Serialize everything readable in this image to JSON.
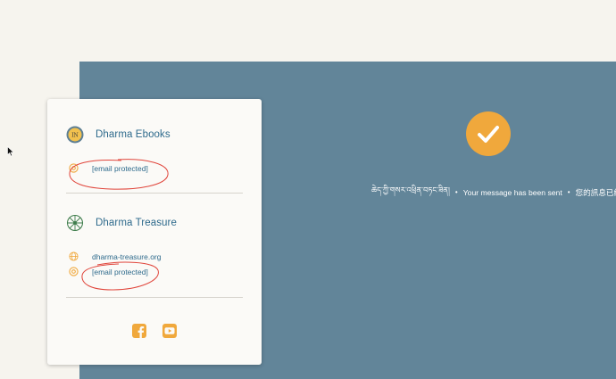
{
  "card": {
    "org1": {
      "name": "Dharma Ebooks",
      "logo_icon": "dharma-ebooks-logo",
      "email": "[email protected]"
    },
    "org2": {
      "name": "Dharma Treasure",
      "logo_icon": "dharma-wheel-logo",
      "website": "dharma-treasure.org",
      "email": "[email protected]"
    },
    "social": [
      "facebook-icon",
      "youtube-icon"
    ]
  },
  "success": {
    "icon": "checkmark-icon",
    "message_tibetan": "ཆེད་ཀྱི་གསར་འཕྲིན་བཏང་ཟིན།",
    "message_english": "Your message has been sent",
    "message_chinese": "您的訊息已經寄出"
  },
  "colors": {
    "panel": "#628599",
    "accent": "#f0a83c",
    "link": "#2e6a8c",
    "annotation": "#e0443a"
  }
}
